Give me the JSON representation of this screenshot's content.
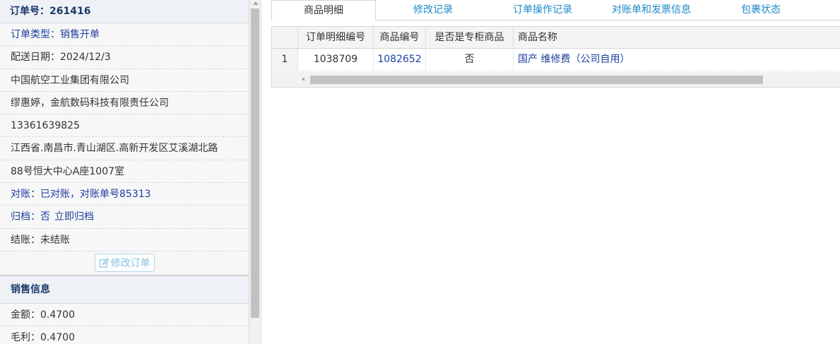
{
  "order": {
    "header": "订单号：261416",
    "type": "订单类型：销售开单",
    "delivery_date": "配送日期：2024/12/3",
    "company": "中国航空工业集团有限公司",
    "contact": "缪惠婷，金航数码科技有限责任公司",
    "phone": "13361639825",
    "address_line1": "江西省.南昌市.青山湖区.高新开发区艾溪湖北路",
    "address_line2": "88号恒大中心A座1007室",
    "reconciliation": "对账：已对账，对账单号85313",
    "archive_label": "归档：",
    "archive_value": "否",
    "archive_action": "立即归档",
    "settlement": "结账：未结账",
    "edit_button": "修改订单"
  },
  "sales": {
    "section_title": "销售信息",
    "amount": "金额：0.4700",
    "gross_profit": "毛利：0.4700"
  },
  "tabs": [
    {
      "label": "商品明细",
      "active": true
    },
    {
      "label": "修改记录",
      "active": false
    },
    {
      "label": "订单操作记录",
      "active": false
    },
    {
      "label": "对账单和发票信息",
      "active": false
    },
    {
      "label": "包裹状态",
      "active": false
    }
  ],
  "grid": {
    "columns": [
      "订单明细编号",
      "商品编号",
      "是否是专柜商品",
      "商品名称"
    ],
    "rows": [
      {
        "index": "1",
        "detail_id": "1038709",
        "product_id": "1082652",
        "is_counter": "否",
        "product_name": "国产 维修费（公司自用）"
      }
    ]
  },
  "colors": {
    "link_blue": "#1d3fa0",
    "tab_blue": "#1e88c8",
    "header_text": "#1c3a6b"
  },
  "icons": {
    "edit_button_icon": "edit-icon"
  }
}
